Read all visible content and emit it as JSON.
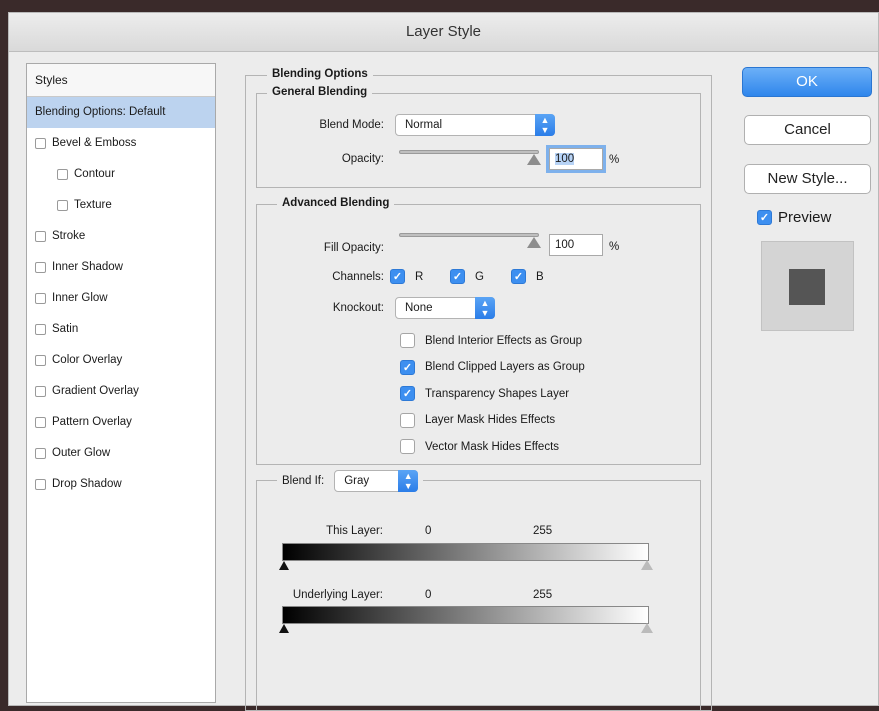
{
  "window": {
    "title": "Layer Style"
  },
  "styles": {
    "header": "Styles",
    "items": [
      {
        "label": "Blending Options: Default",
        "checkbox": false,
        "selected": true,
        "indent": false
      },
      {
        "label": "Bevel & Emboss",
        "checkbox": true,
        "selected": false,
        "indent": false
      },
      {
        "label": "Contour",
        "checkbox": true,
        "selected": false,
        "indent": true
      },
      {
        "label": "Texture",
        "checkbox": true,
        "selected": false,
        "indent": true
      },
      {
        "label": "Stroke",
        "checkbox": true,
        "selected": false,
        "indent": false
      },
      {
        "label": "Inner Shadow",
        "checkbox": true,
        "selected": false,
        "indent": false
      },
      {
        "label": "Inner Glow",
        "checkbox": true,
        "selected": false,
        "indent": false
      },
      {
        "label": "Satin",
        "checkbox": true,
        "selected": false,
        "indent": false
      },
      {
        "label": "Color Overlay",
        "checkbox": true,
        "selected": false,
        "indent": false
      },
      {
        "label": "Gradient Overlay",
        "checkbox": true,
        "selected": false,
        "indent": false
      },
      {
        "label": "Pattern Overlay",
        "checkbox": true,
        "selected": false,
        "indent": false
      },
      {
        "label": "Outer Glow",
        "checkbox": true,
        "selected": false,
        "indent": false
      },
      {
        "label": "Drop Shadow",
        "checkbox": true,
        "selected": false,
        "indent": false
      }
    ]
  },
  "blending": {
    "title": "Blending Options",
    "general": {
      "title": "General Blending",
      "blend_mode_label": "Blend Mode:",
      "blend_mode_value": "Normal",
      "opacity_label": "Opacity:",
      "opacity_value": "100",
      "opacity_unit": "%"
    },
    "advanced": {
      "title": "Advanced Blending",
      "fill_opacity_label": "Fill Opacity:",
      "fill_opacity_value": "100",
      "fill_opacity_unit": "%",
      "channels_label": "Channels:",
      "channel_r": "R",
      "channel_g": "G",
      "channel_b": "B",
      "knockout_label": "Knockout:",
      "knockout_value": "None",
      "options": [
        {
          "label": "Blend Interior Effects as Group",
          "checked": false
        },
        {
          "label": "Blend Clipped Layers as Group",
          "checked": true
        },
        {
          "label": "Transparency Shapes Layer",
          "checked": true
        },
        {
          "label": "Layer Mask Hides Effects",
          "checked": false
        },
        {
          "label": "Vector Mask Hides Effects",
          "checked": false
        }
      ]
    },
    "blend_if": {
      "label": "Blend If:",
      "value": "Gray",
      "this_layer_label": "This Layer:",
      "this_layer_min": "0",
      "this_layer_max": "255",
      "underlying_label": "Underlying Layer:",
      "underlying_min": "0",
      "underlying_max": "255"
    }
  },
  "buttons": {
    "ok": "OK",
    "cancel": "Cancel",
    "new_style": "New Style...",
    "preview_label": "Preview"
  },
  "colors": {
    "accent": "#3d8ff0",
    "selection": "#bcd3ef",
    "preview_swatch": "#555555"
  }
}
